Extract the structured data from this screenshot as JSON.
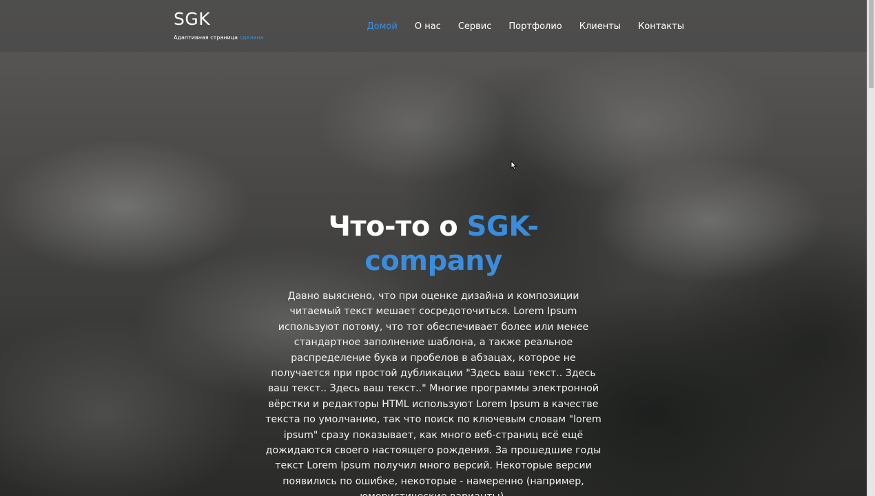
{
  "brand": {
    "title": "SGK",
    "subtitle_prefix": "Адаптивная страница",
    "subtitle_accent": "сделана"
  },
  "nav": {
    "items": [
      {
        "label": "Домой",
        "active": true
      },
      {
        "label": "О нас",
        "active": false
      },
      {
        "label": "Сервис",
        "active": false
      },
      {
        "label": "Портфолио",
        "active": false
      },
      {
        "label": "Клиенты",
        "active": false
      },
      {
        "label": "Контакты",
        "active": false
      }
    ]
  },
  "hero": {
    "title_prefix": "Что-то о",
    "title_accent": "SGK-company",
    "text": "Давно выяснено, что при оценке дизайна и композиции читаемый текст мешает сосредоточиться. Lorem Ipsum используют потому, что тот обеспечивает более или менее стандартное заполнение шаблона, а также реальное распределение букв и пробелов в абзацах, которое не получается при простой дубликации \"Здесь ваш текст.. Здесь ваш текст.. Здесь ваш текст..\" Многие программы электронной вёрстки и редакторы HTML используют Lorem Ipsum в качестве текста по умолчанию, так что поиск по ключевым словам \"lorem ipsum\" сразу показывает, как много веб-страниц всё ещё дожидаются своего настоящего рождения. За прошедшие годы текст Lorem Ipsum получил много версий. Некоторые версии появились по ошибке, некоторые - намеренно (например, юмористические варианты)."
  },
  "colors": {
    "accent": "#3a8dde",
    "navbar_bg": "#464646"
  },
  "icons": {
    "cursor": "mouse-pointer-icon"
  }
}
